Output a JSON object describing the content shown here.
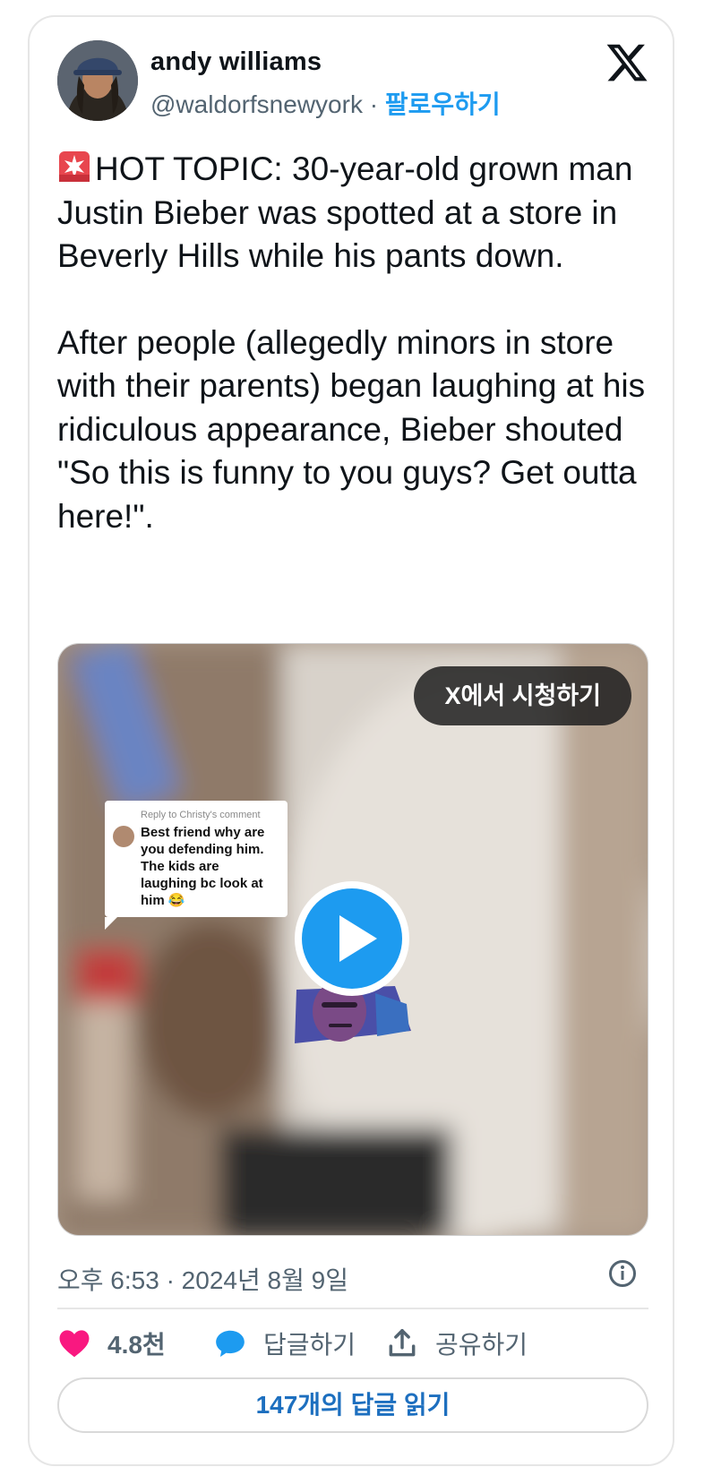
{
  "author": {
    "name": "andy williams",
    "handle": "@waldorfsnewyork",
    "separator": " · ",
    "follow_label": "팔로우하기"
  },
  "tweet": {
    "paragraph_1": "HOT TOPIC: 30-year-old grown man Justin Bieber was spotted at a store in Beverly Hills while his pants down.",
    "paragraph_2": "After people (allegedly minors in store with their parents) began laughing at his ridiculous appearance, Bieber shouted \"So this is funny to you guys? Get outta here!\"."
  },
  "media": {
    "watch_label": "X에서 시청하기",
    "comment_header": "Reply to Christy's comment",
    "comment_body": "Best friend why are you defending him. The kids are laughing bc look at him 😂"
  },
  "meta": {
    "timestamp": "오후 6:53 · 2024년 8월 9일"
  },
  "actions": {
    "likes": "4.8천",
    "reply_label": "답글하기",
    "share_label": "공유하기",
    "read_replies_label": "147개의 답글 읽기"
  },
  "colors": {
    "accent": "#1d9bf0",
    "like": "#f91880",
    "text": "#0f1419",
    "secondary": "#536471"
  },
  "icons": [
    "x-logo-icon",
    "siren-icon",
    "play-icon",
    "info-icon",
    "heart-icon",
    "speech-bubble-icon",
    "share-icon"
  ]
}
